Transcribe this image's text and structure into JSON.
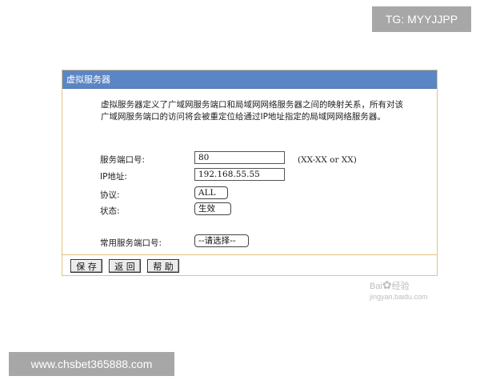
{
  "overlay": {
    "tg_badge": "TG: MYYJJPP",
    "url_badge": "www.chsbet365888.com"
  },
  "panel": {
    "title": "虚拟服务器",
    "description": "虚拟服务器定义了广域网服务端口和局域网网络服务器之间的映射关系，所有对该广域网服务端口的访问将会被重定位给通过IP地址指定的局域网网络服务器。",
    "fields": {
      "service_port": {
        "label": "服务端口号:",
        "value": "80",
        "hint": "(XX-XX or XX)"
      },
      "ip_address": {
        "label": "IP地址:",
        "value": "192.168.55.55"
      },
      "protocol": {
        "label": "协议:",
        "value": "ALL"
      },
      "status": {
        "label": "状态:",
        "value": "生效"
      },
      "common_port": {
        "label": "常用服务端口号:",
        "value": "--请选择--"
      }
    },
    "buttons": {
      "save": "保 存",
      "back": "返 回",
      "help": "帮 助"
    }
  },
  "watermark": {
    "brand": "Bai",
    "brand2": "经验",
    "sub": "jingyan.baidu.com"
  }
}
